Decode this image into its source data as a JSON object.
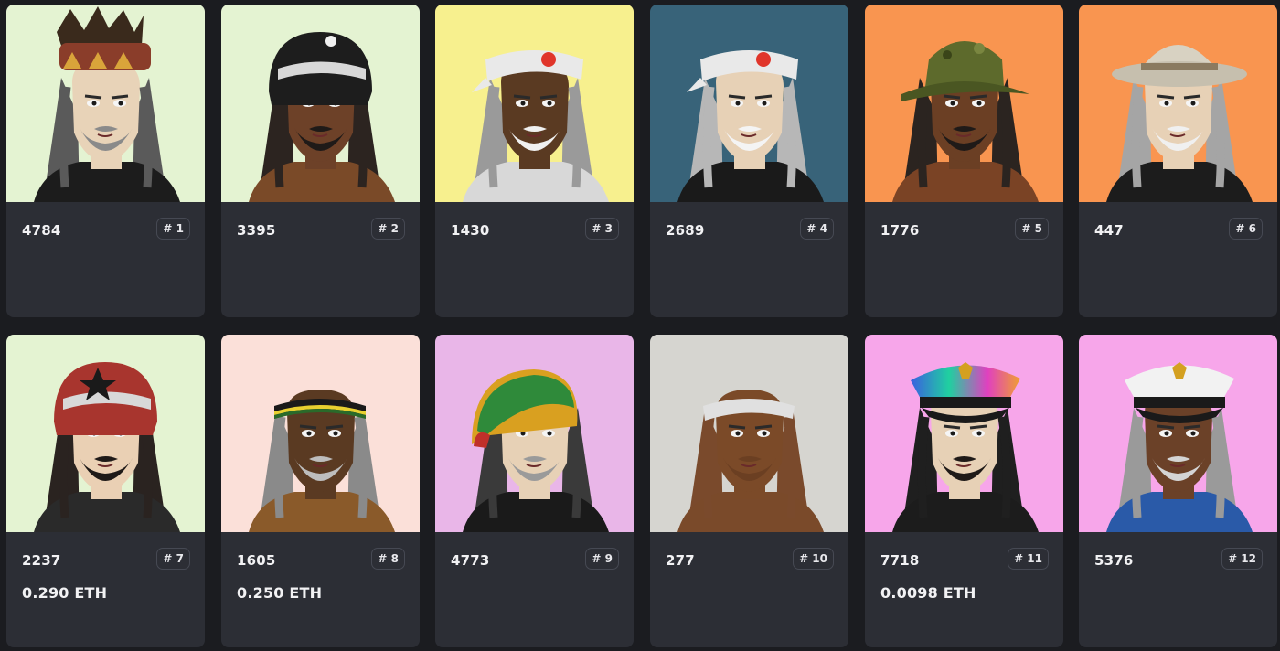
{
  "cards": [
    {
      "id": "4784",
      "rank": "# 1",
      "price": "",
      "bg": "#e4f3d2"
    },
    {
      "id": "3395",
      "rank": "# 2",
      "price": "",
      "bg": "#e4f3d2"
    },
    {
      "id": "1430",
      "rank": "# 3",
      "price": "",
      "bg": "#f7f08e"
    },
    {
      "id": "2689",
      "rank": "# 4",
      "price": "",
      "bg": "#386379"
    },
    {
      "id": "1776",
      "rank": "# 5",
      "price": "",
      "bg": "#f99550"
    },
    {
      "id": "447",
      "rank": "# 6",
      "price": "",
      "bg": "#f99550"
    },
    {
      "id": "2237",
      "rank": "# 7",
      "price": "0.290 ETH",
      "bg": "#e4f3d2"
    },
    {
      "id": "1605",
      "rank": "# 8",
      "price": "0.250 ETH",
      "bg": "#fbe0d9"
    },
    {
      "id": "4773",
      "rank": "# 9",
      "price": "",
      "bg": "#e9b6e8"
    },
    {
      "id": "277",
      "rank": "# 10",
      "price": "",
      "bg": "#d6d5d0"
    },
    {
      "id": "7718",
      "rank": "# 11",
      "price": "0.0098 ETH",
      "bg": "#f7a6ea"
    },
    {
      "id": "5376",
      "rank": "# 12",
      "price": "",
      "bg": "#f7a6ea"
    }
  ],
  "art": [
    {
      "hat": "feather-headband",
      "hatColor": "#8a3d2a",
      "skin": "#e8d3b8",
      "hair": "#5a5a5a",
      "beard": "#8a8a8a",
      "shirt": "#1c1c1c"
    },
    {
      "hat": "helmet",
      "hatColor": "#1d1d1d",
      "skin": "#6d4128",
      "hair": "#2c2420",
      "beard": "#1f1a18",
      "shirt": "#7a4a28"
    },
    {
      "hat": "headband-sun",
      "hatColor": "#e9e9e9",
      "skin": "#5a3a22",
      "hair": "#9a9a9a",
      "beard": "#f0f0f0",
      "shirt": "#d8d8d8"
    },
    {
      "hat": "headband-sun",
      "hatColor": "#e9e9e9",
      "skin": "#e7d1b6",
      "hair": "#b7b7b7",
      "beard": "#f4f4f4",
      "shirt": "#1a1a1a"
    },
    {
      "hat": "bucket",
      "hatColor": "#5d6a2c",
      "skin": "#6b3f24",
      "hair": "#2b2420",
      "beard": "#1f1a18",
      "shirt": "#7a4325"
    },
    {
      "hat": "pith",
      "hatColor": "#d8d2c2",
      "skin": "#e7d1b6",
      "hair": "#a5a5a5",
      "beard": "#f0f0f0",
      "shirt": "#1c1c1c"
    },
    {
      "hat": "helmet-star",
      "hatColor": "#a8352e",
      "skin": "#ead0b4",
      "hair": "#2a2320",
      "beard": "#1f1a18",
      "shirt": "#2a2a2a"
    },
    {
      "hat": "headband-band",
      "hatColor": "#2a6a2a",
      "skin": "#5a3a22",
      "hair": "#8a8a8a",
      "beard": "#bdbdbd",
      "shirt": "#8a5a2a"
    },
    {
      "hat": "rasta",
      "hatColor": "#2f8a3a",
      "skin": "#e7d1b6",
      "hair": "#3a3a3a",
      "beard": "#9a9a9a",
      "shirt": "#1a1a1a"
    },
    {
      "hat": "headband-plain",
      "hatColor": "#e0e0e0",
      "skin": "#7b4a28",
      "hair": "#7a4a2c",
      "beard": "#6b3f22",
      "shirt": "#7a4a2a"
    },
    {
      "hat": "captain-holo",
      "hatColor": "#3a9ad0",
      "skin": "#e7d1b6",
      "hair": "#1f1f1f",
      "beard": "#1f1a18",
      "shirt": "#1c1c1c"
    },
    {
      "hat": "captain",
      "hatColor": "#f2f2f2",
      "skin": "#6b4128",
      "hair": "#9a9a9a",
      "beard": "#d4d4d4",
      "shirt": "#2a5aa8"
    }
  ]
}
